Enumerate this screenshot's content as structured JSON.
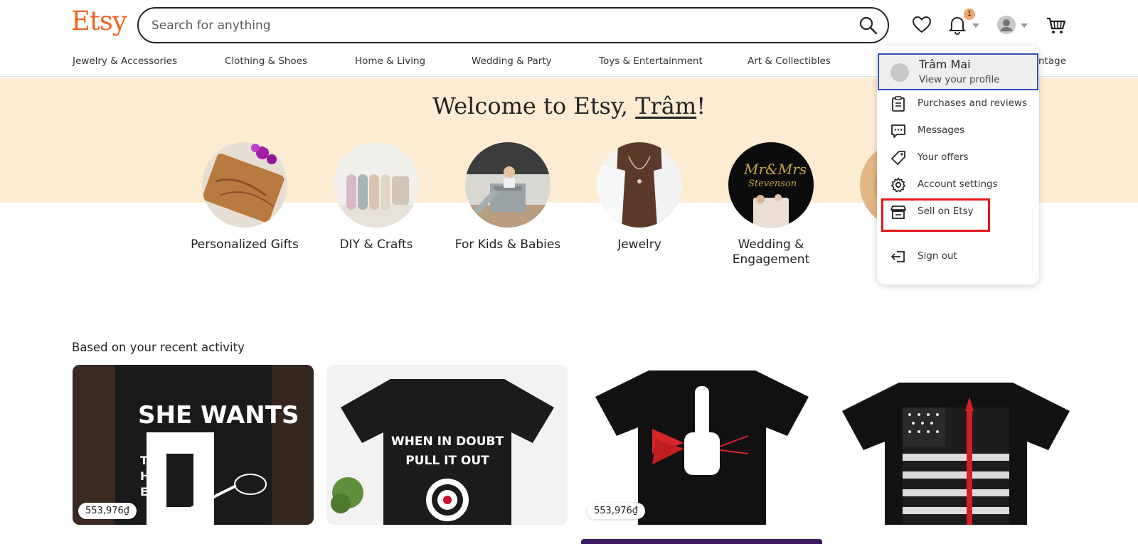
{
  "header": {
    "logo": "Etsy",
    "search_placeholder": "Search for anything",
    "notification_count": "1"
  },
  "nav": {
    "items": [
      "Jewelry & Accessories",
      "Clothing & Shoes",
      "Home & Living",
      "Wedding & Party",
      "Toys & Entertainment",
      "Art & Collectibles",
      "ntage"
    ]
  },
  "welcome": {
    "prefix": "Welcome to Etsy, ",
    "name": "Trâm",
    "suffix": "!"
  },
  "categories": [
    {
      "label": "Personalized Gifts"
    },
    {
      "label": "DIY & Crafts"
    },
    {
      "label": "For Kids & Babies"
    },
    {
      "label": "Jewelry"
    },
    {
      "label": "Wedding & Engagement"
    }
  ],
  "recent": {
    "title": "Based on your recent activity",
    "items": [
      {
        "price": "553,976₫",
        "shirt_text": "SHE WANTS"
      },
      {
        "price": "",
        "shirt_text": "WHEN IN DOUBT PULL IT OUT"
      },
      {
        "price": "553,976₫",
        "shirt_text": ""
      },
      {
        "price": "",
        "shirt_text": ""
      }
    ]
  },
  "menu": {
    "profile_name": "Trâm Mai",
    "profile_sub": "View your profile",
    "items": [
      {
        "label": "Purchases and reviews",
        "icon": "clipboard-icon"
      },
      {
        "label": "Messages",
        "icon": "chat-icon"
      },
      {
        "label": "Your offers",
        "icon": "tag-icon"
      },
      {
        "label": "Account settings",
        "icon": "gear-icon"
      },
      {
        "label": "Sell on Etsy",
        "icon": "shop-icon"
      },
      {
        "label": "Sign out",
        "icon": "sign-out-icon"
      }
    ]
  },
  "colors": {
    "brand": "#f1641e",
    "banner": "#fdebd2",
    "highlight": "#e8151b",
    "focus": "#2f50b4"
  }
}
